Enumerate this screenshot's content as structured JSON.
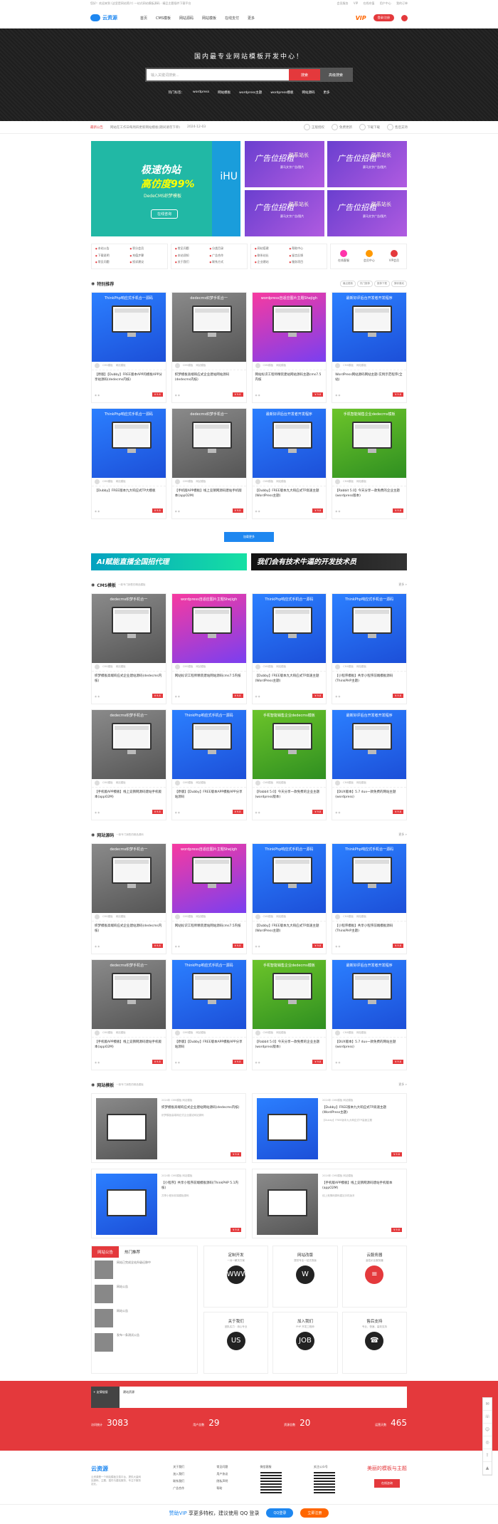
{
  "topbar": {
    "left": "您好！欢迎来到 (这里是网站简介) 一站式网站模板源码 · 精品主题插件下载平台",
    "links": [
      "会员服务",
      "VIP",
      "在线充值",
      "用户中心",
      "我的订单"
    ]
  },
  "header": {
    "logo": "云资源",
    "nav": [
      "首页",
      "CMS模板",
      "网站源码",
      "网站模板",
      "在线支付",
      "更多"
    ],
    "vip": "VIP",
    "login": "登录/注册"
  },
  "hero": {
    "title": "国内最专业网站模板开发中心！",
    "placeholder": "输入关键词搜索...",
    "search_btn": "搜索",
    "adv_btn": "高级搜索",
    "hot_label": "热门标签：",
    "hot": [
      "wordpress",
      "网站模板",
      "wordpress主题",
      "wordpress模板",
      "网站源码",
      "更多"
    ]
  },
  "notice": {
    "label": "最新公告",
    "text": "网站在工作日每周四更新网站模板(期间请勿下单)",
    "date": "2024-12-03",
    "actions": [
      "正版授权",
      "免费更新",
      "下载下载",
      "售后支持"
    ]
  },
  "banner": {
    "main_t1": "极速伪站",
    "main_t2": "高仿度99%",
    "main_t3": "DedeCMS织梦模板",
    "main_btn": "在线咨询",
    "main_brand": "iHU",
    "ad_text": "广告位招租",
    "ad_contact": "联系站长",
    "ad_sub": "赛马文字广告/图片"
  },
  "quick": {
    "box1": [
      "本站公告",
      "积分会员",
      "下载说明",
      "充值步骤",
      "常见问题",
      "投诉建议"
    ],
    "box2": [
      "常见问题",
      "分类目录",
      "本站须知",
      "广告合作",
      "关于我们",
      "联系方式"
    ],
    "box3": [
      "网站搭建",
      "帮助中心",
      "联系站长",
      "留言反馈",
      "企业建站",
      "服务项目"
    ],
    "icons": [
      "在线客服",
      "会员中心",
      "VIP会员"
    ]
  },
  "featured": {
    "title": "特别推荐",
    "tabs": [
      "最近更新",
      "热门推荐",
      "推荐下载",
      "猜你喜欢"
    ],
    "cards": [
      {
        "head": "ThinkPhp响应式手机合一源码",
        "title": "【原版】【Dubby】FREE版本APP的模板APP分享站源码(dedecms内核)",
        "price": "¥ 9.8",
        "color": "blue"
      },
      {
        "head": "dedecms织梦手机合一",
        "title": "织梦模板高端响应式企业建站网站源码(dedecms内核)",
        "price": "¥ 9.8",
        "color": "gray"
      },
      {
        "head": "wordpress自适应图片主题Shejigh",
        "title": "网站标识工程师精装建站网站源码主题cms7.5内核",
        "price": "¥ 9.8",
        "color": "pink"
      },
      {
        "head": "最新好评后台开发者开发程序",
        "title": "WordPress网站源码网站主题-实例示范程序(全站)",
        "price": "¥ 9.8",
        "color": "blue"
      },
      {
        "head": "ThinkPhp响应式手机合一源码",
        "title": "【Dubby】FREE版本九大响应式TP大模板",
        "price": "¥ 9.8",
        "color": "blue"
      },
      {
        "head": "dedecms织梦手机合一",
        "title": "【手机版APP模板】线上竞猜网源码建站手机版本(appO2M)",
        "price": "¥ 9.8",
        "color": "gray"
      },
      {
        "head": "最新好评后台开发者开发程序",
        "title": "【Dubby】FREE版本九大响应式TP高速主题(WordPress主题)",
        "price": "¥ 9.8",
        "color": "blue"
      },
      {
        "head": "手机智能销售企业dedecms模板",
        "title": "【Rabbit 5.0】今天分享一款免费的企业主题(wordpress版本)",
        "price": "¥ 9.8",
        "color": "green"
      }
    ],
    "loadmore": "加载更多"
  },
  "adstrip": [
    "AI赋能直播全国招代理",
    "我们会有技术牛逼的开发技术员"
  ],
  "cms": {
    "title": "CMS模板",
    "sub": "一款专门销售的精品模板",
    "more": "更多 »",
    "cards": [
      {
        "head": "dedecms织梦手机合一",
        "title": "织梦模板高端响应式企业建站源码(dedecms内核)",
        "price": "¥ 9.8",
        "color": "gray"
      },
      {
        "head": "wordpress自适应图片主题Shejigh",
        "title": "网站标识工程师精装建站网站源码cms7.5内核",
        "price": "¥ 9.8",
        "color": "pink"
      },
      {
        "head": "ThinkPhp响应式手机合一源码",
        "title": "【Dubby】FREE版本九大响应式TP高速主题(WordPress主题)",
        "price": "¥ 9.8",
        "color": "blue"
      },
      {
        "head": "ThinkPhp响应式手机合一源码",
        "title": "【小程序模板】共享小程序前端模板源码(ThinkPHP主题)",
        "price": "¥ 9.8",
        "color": "blue"
      },
      {
        "head": "dedecms织梦手机合一",
        "title": "【手机版APP模板】线上竞猜网源码建站手机版本(appO2M)",
        "price": "¥ 9.8",
        "color": "gray"
      },
      {
        "head": "ThinkPhp响应式手机合一源码",
        "title": "【原版】【Dubby】FREE版本APP模板APP分享站源码",
        "price": "¥ 9.8",
        "color": "blue"
      },
      {
        "head": "手机智能销售企业dedecms模板",
        "title": "【Rabbit 5.0】今天分享一款免费的企业主题(wordpress版本)",
        "price": "¥ 9.8",
        "color": "green"
      },
      {
        "head": "最新好评后台开发者开发程序",
        "title": "【DUX版本】5.7 dux一款免费的网站主题(wordpress)",
        "price": "¥ 9.8",
        "color": "blue"
      }
    ]
  },
  "src": {
    "title": "网站源码",
    "sub": "一款专门销售的精品源码",
    "more": "更多 »",
    "cards": [
      {
        "head": "dedecms织梦手机合一",
        "title": "织梦模板高端响应式企业建站源码(dedecms内核)",
        "price": "¥ 9.8",
        "color": "gray"
      },
      {
        "head": "wordpress自适应图片主题Shejigh",
        "title": "网站标识工程师精装建站网站源码cms7.5内核",
        "price": "¥ 9.8",
        "color": "pink"
      },
      {
        "head": "ThinkPhp响应式手机合一源码",
        "title": "【Dubby】FREE版本九大响应式TP高速主题(WordPress主题)",
        "price": "¥ 9.8",
        "color": "blue"
      },
      {
        "head": "ThinkPhp响应式手机合一源码",
        "title": "【小程序模板】共享小程序前端模板源码(ThinkPHP主题)",
        "price": "¥ 9.8",
        "color": "blue"
      },
      {
        "head": "dedecms织梦手机合一",
        "title": "【手机版APP模板】线上竞猜网源码建站手机版本(appO2M)",
        "price": "¥ 9.8",
        "color": "gray"
      },
      {
        "head": "ThinkPhp响应式手机合一源码",
        "title": "【原版】【Dubby】FREE版本APP模板APP分享站源码",
        "price": "¥ 9.8",
        "color": "blue"
      },
      {
        "head": "手机智能销售企业dedecms模板",
        "title": "【Rabbit 5.0】今天分享一款免费的企业主题(wordpress版本)",
        "price": "¥ 9.8",
        "color": "green"
      },
      {
        "head": "最新好评后台开发者开发程序",
        "title": "【DUX版本】5.7 dux一款免费的网站主题(wordpress)",
        "price": "¥ 9.8",
        "color": "blue"
      }
    ]
  },
  "tpl": {
    "title": "网站模板",
    "sub": "一款专门销售的精品模板",
    "more": "更多 »",
    "cards": [
      {
        "meta": "2024年 CMS模板 网站模板",
        "title": "织梦模板高端响应式企业建站网站源码(dedecms内核)",
        "desc": "织梦模板高端响应式企业建站网站源码",
        "price": "¥ 9.8",
        "color": "gray"
      },
      {
        "meta": "2024年 CMS模板 网站模板",
        "title": "【Dubby】FREE版本九大响应式TP高速主题(WordPress主题)",
        "desc": "【Dubby】FREE版本九大响应式TP高速主题",
        "price": "¥ 9.8",
        "color": "blue"
      },
      {
        "meta": "2024年 CMS模板 网站模板",
        "title": "【小程序】共享小程序前端模板源码(ThinkPHP 5.1内核)",
        "desc": "共享小程序前端模板源码",
        "price": "¥ 9.8",
        "color": "blue"
      },
      {
        "meta": "2024年 CMS模板 网站模板",
        "title": "【手机版APP模板】线上竞猜网源码建站手机版本(appO2M)",
        "desc": "线上竞猜网源码建站手机版本",
        "price": "¥ 9.8",
        "color": "gray"
      }
    ]
  },
  "board": {
    "tab1": "网站公告",
    "tab2": "热门推荐",
    "items": [
      "网站已完成全站升级迁移中",
      "网站公告",
      "网站公告",
      "发布一条测试公告"
    ]
  },
  "services": [
    {
      "t": "定制开发",
      "s": "一对一解决方案",
      "i": "WWW"
    },
    {
      "t": "网站改版",
      "s": "提供专业一站式改版",
      "i": "W"
    },
    {
      "t": "云服务器",
      "s": "高性价比服务器",
      "i": "≡"
    },
    {
      "t": "关于我们",
      "s": "团队实力 · 用心专业",
      "i": "US"
    },
    {
      "t": "加入我们",
      "s": "PHP 开发工程师",
      "i": "JOB"
    },
    {
      "t": "售后支持",
      "s": "专业、快速、高效支持",
      "i": "☎"
    }
  ],
  "stats": {
    "bar_left": "+ 友情链接",
    "bar_right": "建站资源",
    "items": [
      {
        "l": "访问统计",
        "v": "3083"
      },
      {
        "l": "用户总数",
        "v": "29"
      },
      {
        "l": "资源总数",
        "v": "20"
      },
      {
        "l": "运营天数",
        "v": "465"
      }
    ]
  },
  "footer": {
    "logo": "云资源",
    "desc": "云资源是一个网站模板交易平台，提供大量网站源码、主题、插件与建站服务，专注于服务站长。",
    "col1": [
      "关于我们",
      "加入我们",
      "联系我们",
      "广告合作"
    ],
    "col2": [
      "常见问题",
      "用户协议",
      "隐私声明",
      "帮助"
    ],
    "qr1": "微信客服",
    "qr2": "关注公众号",
    "cta": "美丽的模板与主题",
    "cta_btn": "在线咨询"
  },
  "bottombar": {
    "text1": "赞助VIP",
    "text2": "享更多特权，建议使用 QQ 登录",
    "b1": "QQ登录",
    "b2": "立即注册"
  }
}
